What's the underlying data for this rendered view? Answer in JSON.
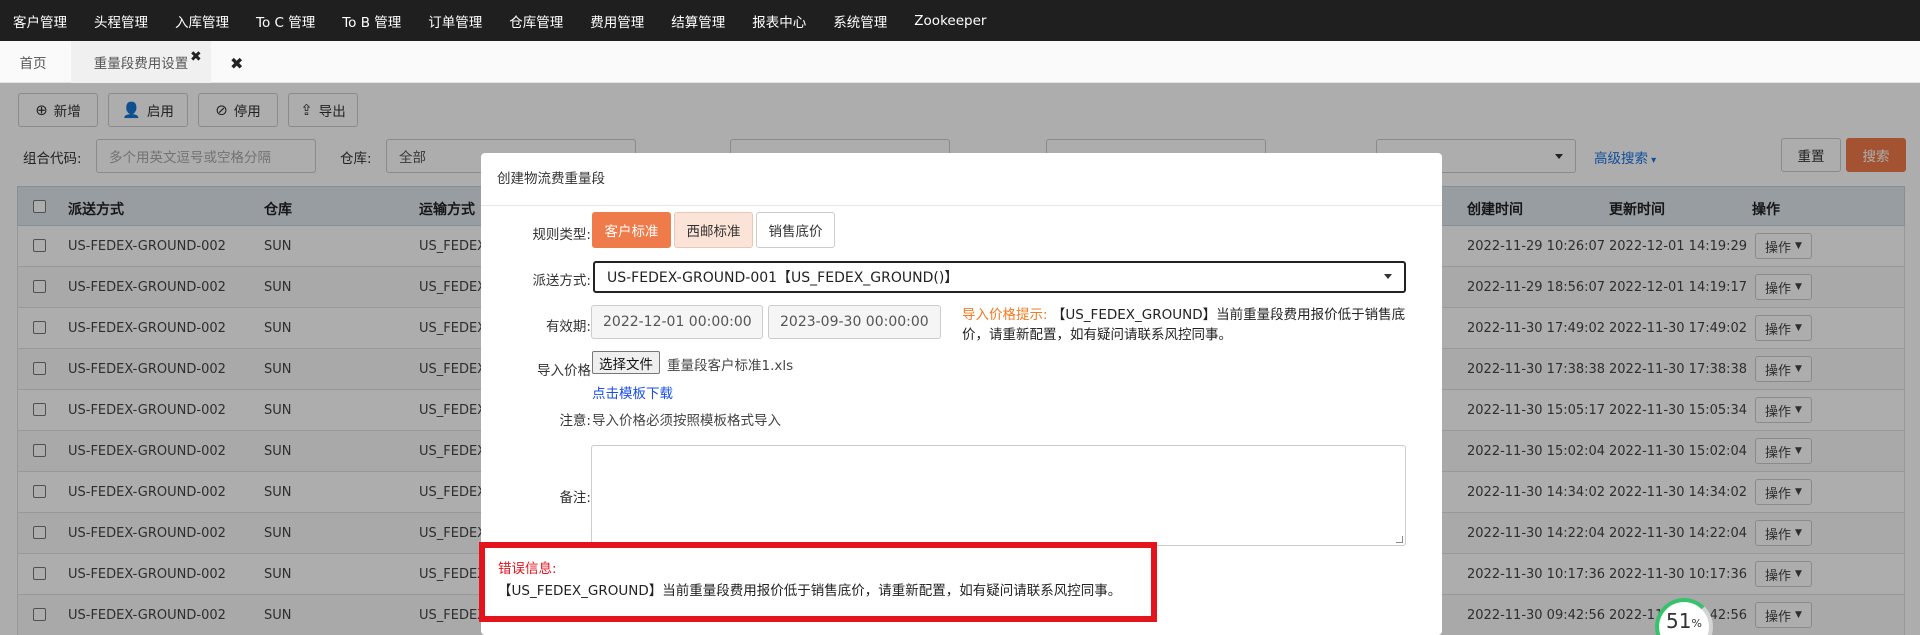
{
  "nav": [
    "客户管理",
    "头程管理",
    "入库管理",
    "To C 管理",
    "To B 管理",
    "订单管理",
    "仓库管理",
    "费用管理",
    "结算管理",
    "报表中心",
    "系统管理",
    "Zookeeper"
  ],
  "tabs": {
    "home": "首页",
    "active": "重量段费用设置",
    "close_all": "✖"
  },
  "toolbar": {
    "add": "新增",
    "enable": "启用",
    "disable": "停用",
    "export": "导出"
  },
  "filters": {
    "combo_label": "组合代码:",
    "combo_placeholder": "多个用英文逗号或空格分隔",
    "warehouse_label": "仓库:",
    "warehouse_value": "全部",
    "advanced": "高级搜索",
    "reset": "重置",
    "search": "搜索"
  },
  "table": {
    "headers": {
      "delivery": "派送方式",
      "warehouse": "仓库",
      "transport": "运输方式",
      "created": "创建时间",
      "updated": "更新时间",
      "action": "操作"
    },
    "op_label": "操作",
    "rows": [
      {
        "delivery": "US-FEDEX-GROUND-002",
        "warehouse": "SUN",
        "transport": "US_FEDEX_",
        "created": "2022-11-29 10:26:07",
        "updated": "2022-12-01 14:19:29"
      },
      {
        "delivery": "US-FEDEX-GROUND-002",
        "warehouse": "SUN",
        "transport": "US_FEDEX_",
        "created": "2022-11-29 18:56:07",
        "updated": "2022-12-01 14:19:17"
      },
      {
        "delivery": "US-FEDEX-GROUND-002",
        "warehouse": "SUN",
        "transport": "US_FEDEX_",
        "created": "2022-11-30 17:49:02",
        "updated": "2022-11-30 17:49:02"
      },
      {
        "delivery": "US-FEDEX-GROUND-002",
        "warehouse": "SUN",
        "transport": "US_FEDEX_",
        "created": "2022-11-30 17:38:38",
        "updated": "2022-11-30 17:38:38"
      },
      {
        "delivery": "US-FEDEX-GROUND-002",
        "warehouse": "SUN",
        "transport": "US_FEDEX_",
        "created": "2022-11-30 15:05:17",
        "updated": "2022-11-30 15:05:34"
      },
      {
        "delivery": "US-FEDEX-GROUND-002",
        "warehouse": "SUN",
        "transport": "US_FEDEX_",
        "created": "2022-11-30 15:02:04",
        "updated": "2022-11-30 15:02:04"
      },
      {
        "delivery": "US-FEDEX-GROUND-002",
        "warehouse": "SUN",
        "transport": "US_FEDEX_",
        "created": "2022-11-30 14:34:02",
        "updated": "2022-11-30 14:34:02"
      },
      {
        "delivery": "US-FEDEX-GROUND-002",
        "warehouse": "SUN",
        "transport": "US_FEDEX_",
        "created": "2022-11-30 14:22:04",
        "updated": "2022-11-30 14:22:04"
      },
      {
        "delivery": "US-FEDEX-GROUND-002",
        "warehouse": "SUN",
        "transport": "US_FEDEX_",
        "created": "2022-11-30 10:17:36",
        "updated": "2022-11-30 10:17:36"
      },
      {
        "delivery": "US-FEDEX-GROUND-002",
        "warehouse": "SUN",
        "transport": "US_FEDEX_",
        "created": "2022-11-30 09:42:56",
        "updated": "2022-11-30 09:42:56"
      }
    ]
  },
  "modal": {
    "title": "创建物流费重量段",
    "rule_label": "规则类型:",
    "rule_options": [
      "客户标准",
      "西邮标准",
      "销售底价"
    ],
    "delivery_label": "派送方式:",
    "delivery_value": "US-FEDEX-GROUND-001【US_FEDEX_GROUND()】",
    "valid_label": "有效期:",
    "date_start": "2022-12-01 00:00:00",
    "date_end": "2023-09-30 00:00:00",
    "hint_label": "导入价格提示:",
    "hint_text": "【US_FEDEX_GROUND】当前重量段费用报价低于销售底价，请重新配置，如有疑问请联系风控同事。",
    "import_label": "导入价格",
    "file_button": "选择文件",
    "file_name": "重量段客户标准1.xls",
    "template_link": "点击模板下载",
    "note_label": "注意:",
    "note_text": "导入价格必须按照模板格式导入",
    "remark_label": "备注:",
    "error_title": "错误信息:",
    "error_msg": "【US_FEDEX_GROUND】当前重量段费用报价低于销售底价，请重新配置，如有疑问请联系风控同事。"
  },
  "progress": {
    "value": "51",
    "unit": "%"
  }
}
